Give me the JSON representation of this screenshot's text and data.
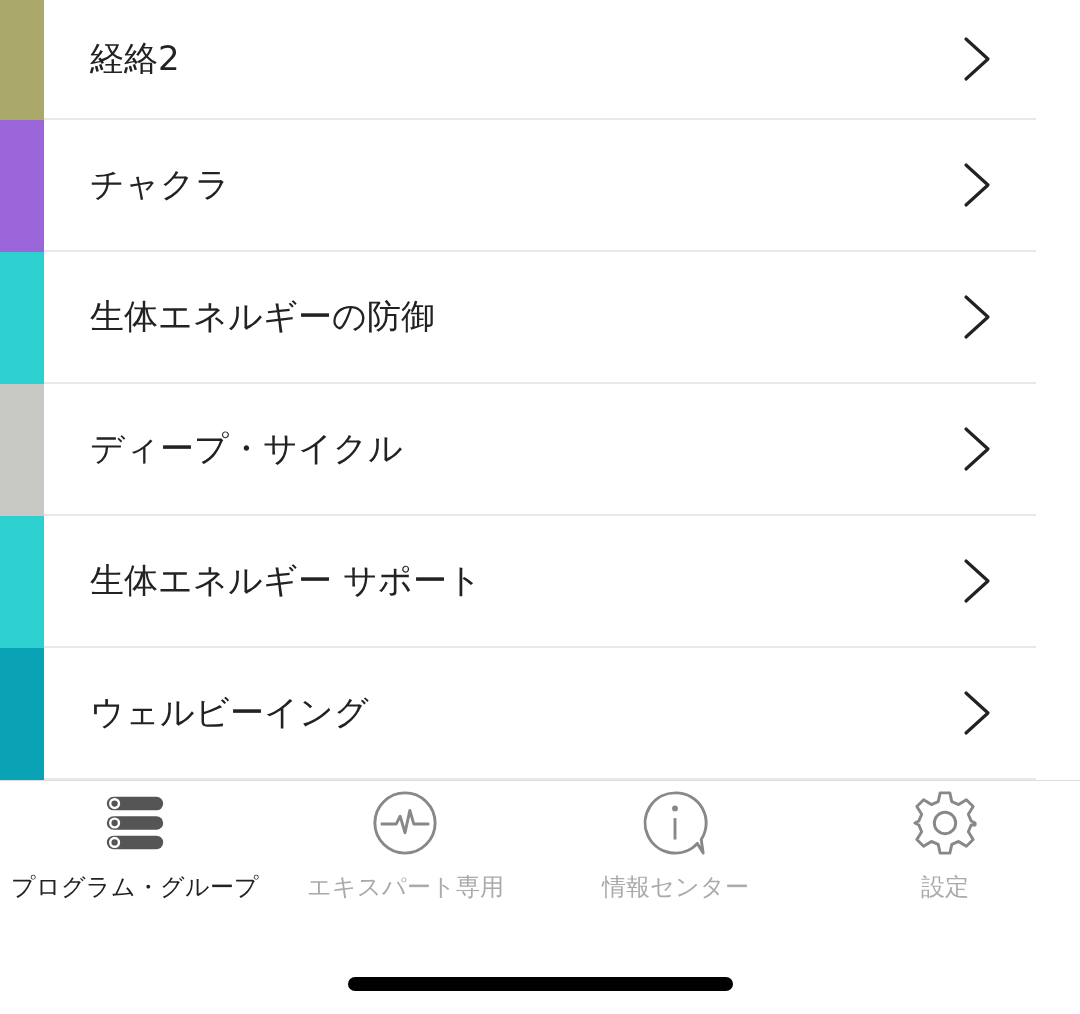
{
  "groups": [
    {
      "label": "経絡2",
      "color": "#aba86b"
    },
    {
      "label": "チャクラ",
      "color": "#9b66d9"
    },
    {
      "label": "生体エネルギーの防御",
      "color": "#2ecfcf"
    },
    {
      "label": "ディープ・サイクル",
      "color": "#c8c8c4"
    },
    {
      "label": "生体エネルギー サポート",
      "color": "#2ecfcf"
    },
    {
      "label": "ウェルビーイング",
      "color": "#0aa3b5"
    }
  ],
  "tab_bar": [
    {
      "kind": "list",
      "label": "プログラム・グループ",
      "selected": true
    },
    {
      "kind": "pulse",
      "label": "エキスパート専用",
      "selected": false
    },
    {
      "kind": "info",
      "label": "情報センター",
      "selected": false
    },
    {
      "kind": "gear",
      "label": "設定",
      "selected": false
    }
  ]
}
